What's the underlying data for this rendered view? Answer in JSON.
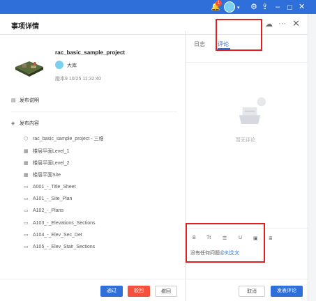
{
  "topbar": {
    "notification_count": "1",
    "icons": [
      "bell-icon",
      "avatar",
      "settings-icon",
      "upload-icon",
      "minimize-icon",
      "maximize-icon",
      "close-icon"
    ]
  },
  "header": {
    "title": "事项详情",
    "icons": [
      "wechat-icon",
      "more-icon",
      "close-icon"
    ]
  },
  "project": {
    "name": "rac_basic_sample_project",
    "user": "大库",
    "version": "版本9 10/25 11:32:40"
  },
  "sections": {
    "description": "发布说明",
    "contents": "发布内容"
  },
  "files": [
    {
      "icon": "cube-icon",
      "name": "rac_basic_sample_project - 三维"
    },
    {
      "icon": "floorplan-icon",
      "name": "楼层平面Level_1"
    },
    {
      "icon": "floorplan-icon",
      "name": "楼层平面Level_2"
    },
    {
      "icon": "floorplan-icon",
      "name": "楼层平面Site"
    },
    {
      "icon": "sheet-icon",
      "name": "A001_-_Title_Sheet"
    },
    {
      "icon": "sheet-icon",
      "name": "A101_-_Site_Plan"
    },
    {
      "icon": "sheet-icon",
      "name": "A102_-_Plans"
    },
    {
      "icon": "sheet-icon",
      "name": "A103_-_Elevations_Sections"
    },
    {
      "icon": "sheet-icon",
      "name": "A104_-_Elev_Sec_Det"
    },
    {
      "icon": "sheet-icon",
      "name": "A105_-_Elev_Stair_Sections"
    }
  ],
  "footer_left": {
    "approve": "通过",
    "reject": "驳回",
    "withdraw": "撤回"
  },
  "tabs": {
    "log": "日志",
    "comments": "评论"
  },
  "empty": {
    "text": "暂无评论"
  },
  "editor": {
    "toolbar": [
      "B",
      "Tt",
      "☰",
      "U",
      "▣",
      "≣"
    ],
    "text": "没有任何问题",
    "mention": "@刘艾文"
  },
  "footer_right": {
    "cancel": "取消",
    "submit": "发表评论"
  },
  "colors": {
    "accent": "#2f6fd9",
    "danger": "#f5503c",
    "highlight": "#e02020"
  }
}
